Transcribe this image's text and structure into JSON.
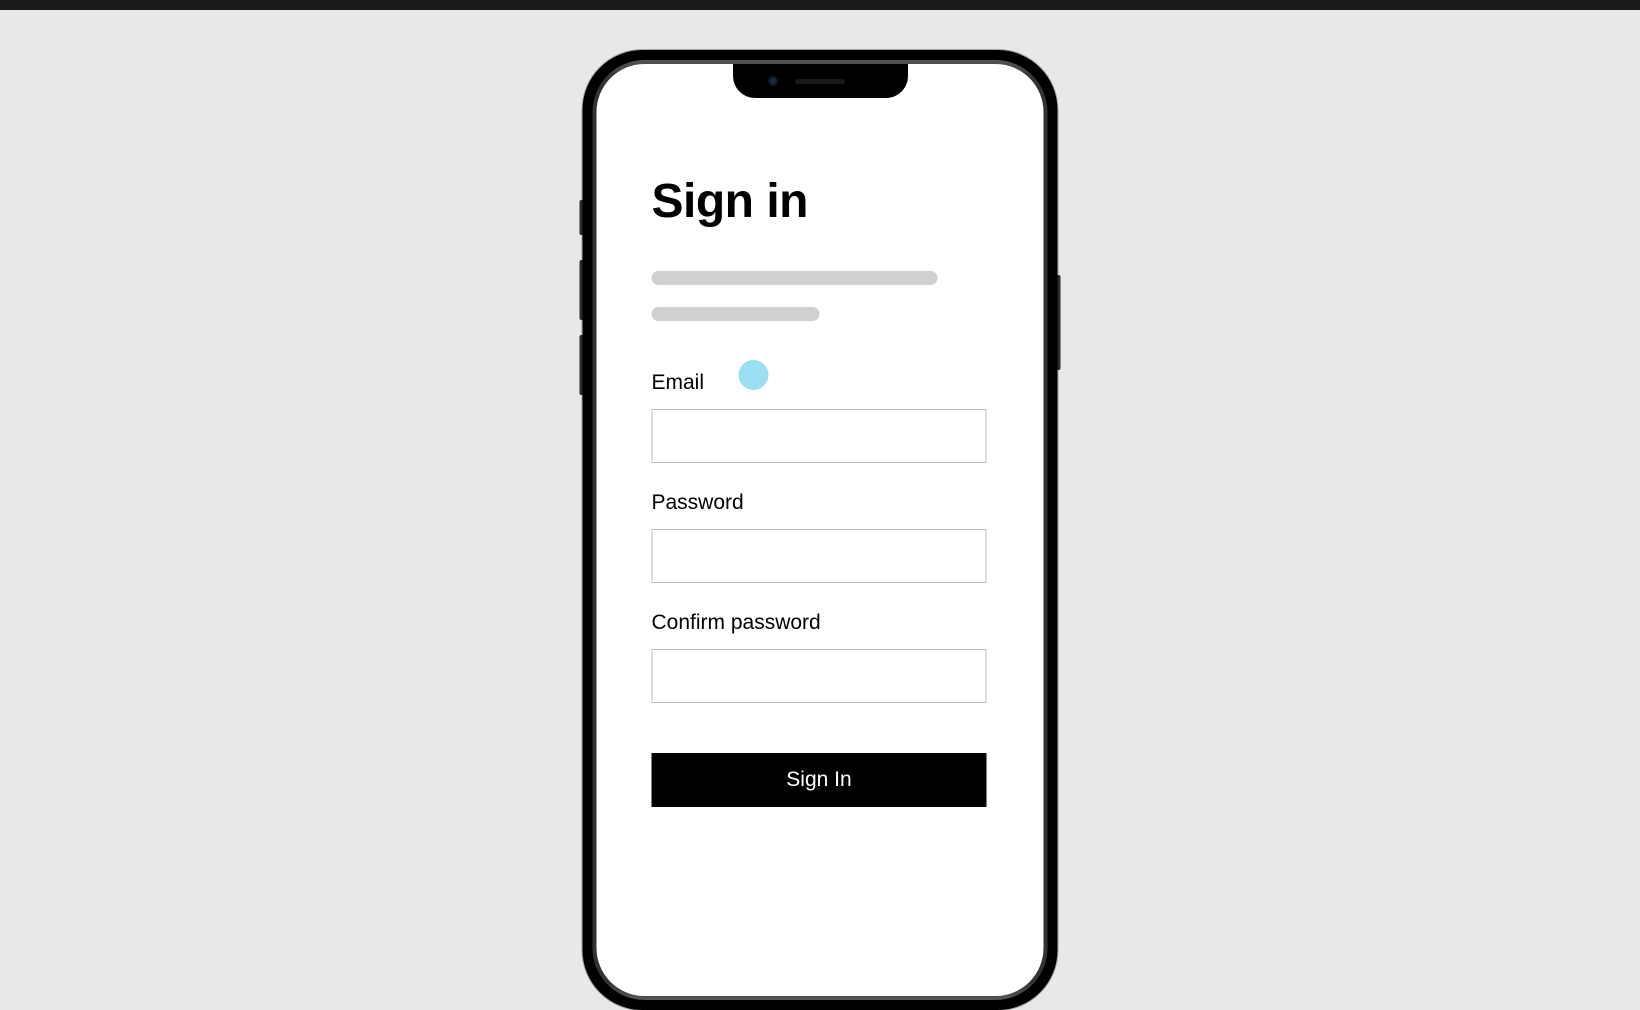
{
  "title": "Sign in",
  "form": {
    "email": {
      "label": "Email",
      "value": ""
    },
    "password": {
      "label": "Password",
      "value": ""
    },
    "confirmPassword": {
      "label": "Confirm password",
      "value": ""
    }
  },
  "submitButton": {
    "label": "Sign In"
  }
}
